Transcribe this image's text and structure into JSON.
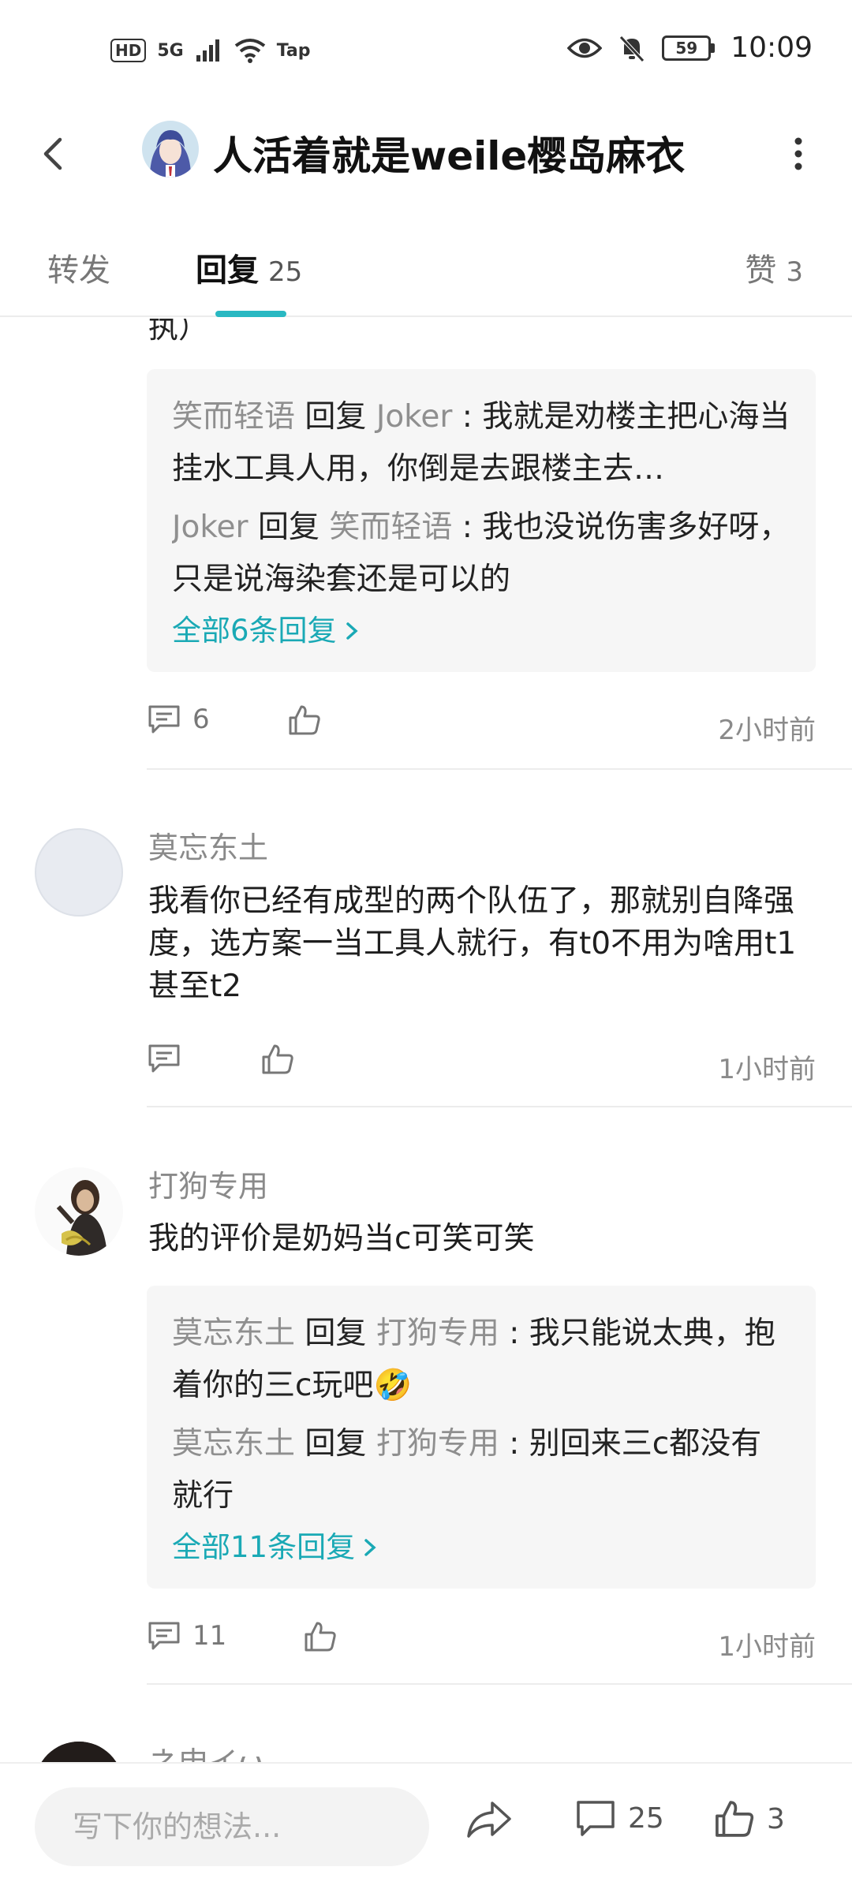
{
  "status_bar": {
    "hd": "HD",
    "network": "5G",
    "tap": "Tap",
    "battery": "59",
    "time": "10:09"
  },
  "header": {
    "title": "人活着就是weile樱岛麻衣"
  },
  "tabs": {
    "repost": "转发",
    "reply": "回复",
    "reply_count": "25",
    "like": "赞",
    "like_count": "3"
  },
  "partial_comment": {
    "cut_text": "执）",
    "replies": [
      {
        "from": "笑而轻语",
        "verb": " 回复 ",
        "to": "Joker",
        "text": "我就是劝楼主把心海当挂水工具人用，你倒是去跟楼主去…"
      },
      {
        "from": "Joker",
        "verb": " 回复 ",
        "to": "笑而轻语",
        "text": "我也没说伤害多好呀，只是说海染套还是可以的"
      }
    ],
    "view_all": "全部6条回复",
    "comment_count": "6",
    "time": "2小时前"
  },
  "comments": [
    {
      "name": "莫忘东土",
      "body": "我看你已经有成型的两个队伍了，那就别自降强度，选方案一当工具人就行，有t0不用为啥用t1甚至t2",
      "time": "1小时前"
    },
    {
      "name": "打狗专用",
      "body": "我的评价是奶妈当c可笑可笑",
      "replies": [
        {
          "from": "莫忘东土",
          "verb": " 回复 ",
          "to": "打狗专用",
          "text": "我只能说太典，抱着你的三c玩吧🤣"
        },
        {
          "from": "莫忘东土",
          "verb": " 回复 ",
          "to": "打狗专用",
          "text": "别回来三c都没有就行"
        }
      ],
      "view_all": "全部11条回复",
      "comment_count": "11",
      "time": "1小时前"
    },
    {
      "name": "ネ申イω"
    }
  ],
  "bottom_bar": {
    "input_placeholder": "写下你的想法...",
    "comment_count": "25",
    "like_count": "3"
  },
  "colors": {
    "accent": "#1aa9b5",
    "indicator": "#29b8c2",
    "muted_name": "#8f8f8f",
    "reply_bg": "#f6f6f6"
  }
}
